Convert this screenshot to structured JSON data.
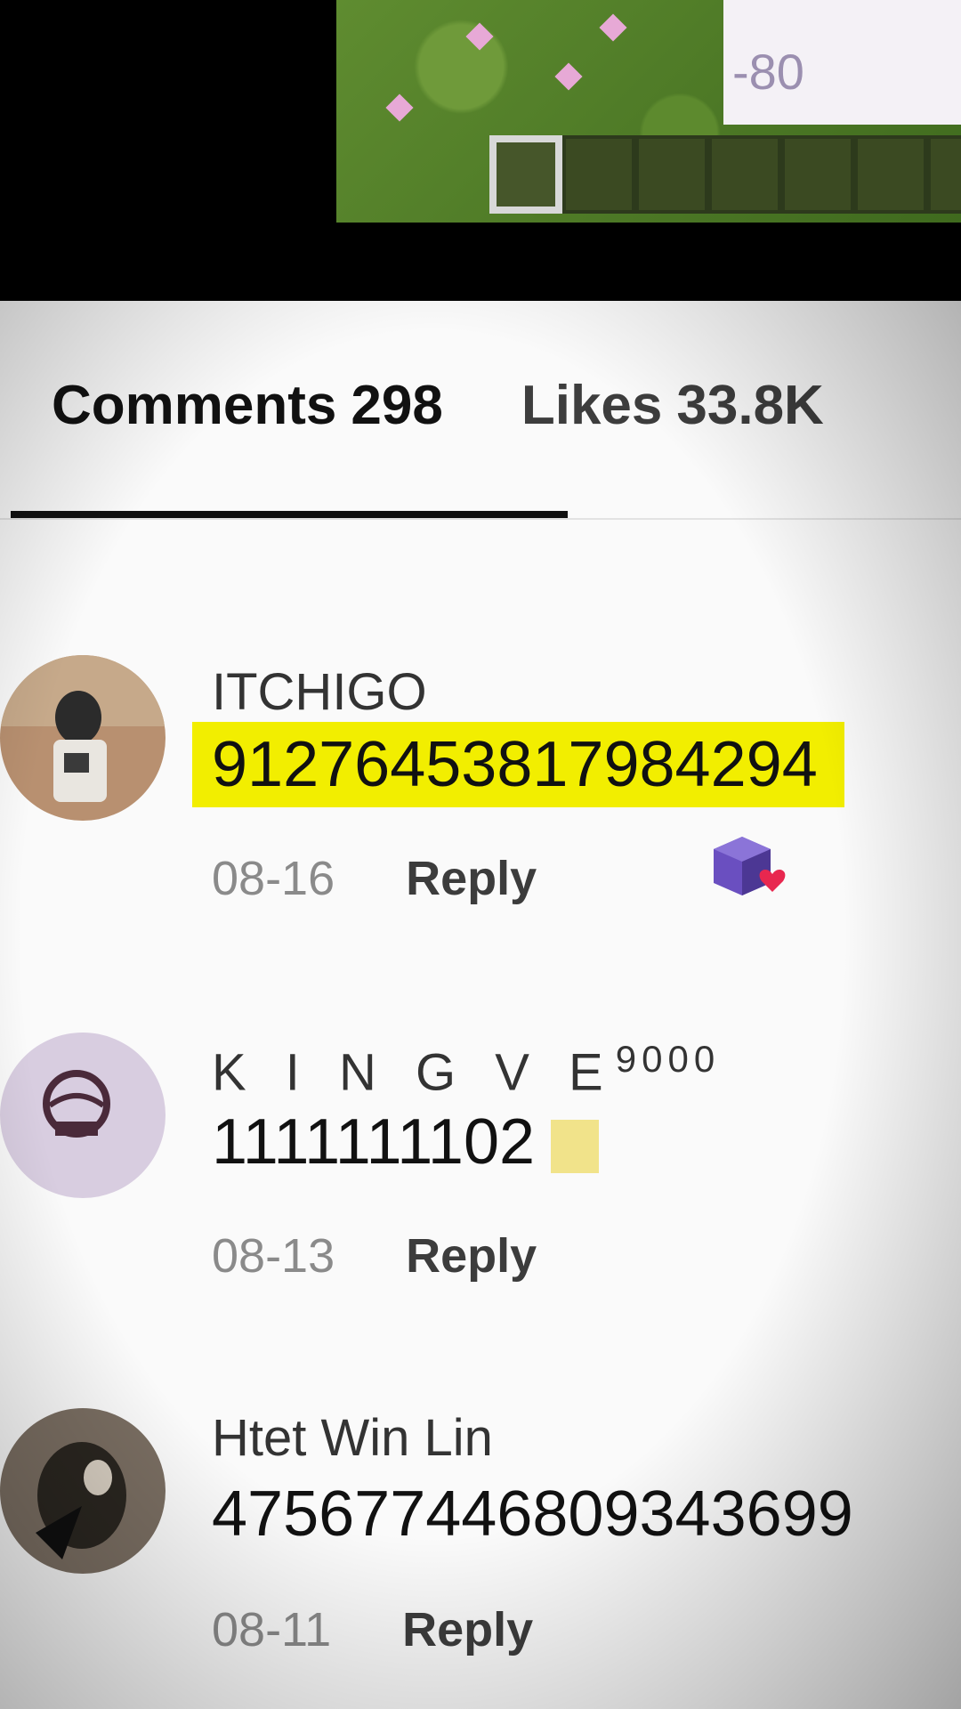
{
  "video": {
    "hud_value": "-80",
    "hotbar_slot_count": 7,
    "selected_slot": 1
  },
  "tabs": {
    "comments": {
      "label": "Comments",
      "count": "298"
    },
    "likes": {
      "label": "Likes",
      "count": "33.8K"
    }
  },
  "comments": [
    {
      "username": "ITCHIGO",
      "text": "91276453817984294",
      "highlighted": true,
      "date": "08-16",
      "reply": "Reply",
      "badge": "creator-liked-icon"
    },
    {
      "username": "K I N G V E",
      "username_sup": "9000",
      "text": "1111111102",
      "date": "08-13",
      "reply": "Reply"
    },
    {
      "username": "Htet Win Lin",
      "text": "475677446809343699",
      "date": "08-11",
      "reply": "Reply"
    }
  ],
  "colors": {
    "highlight": "#f2ee00",
    "liked_heart": "#e8274f",
    "cube": "#6a4fc0"
  }
}
